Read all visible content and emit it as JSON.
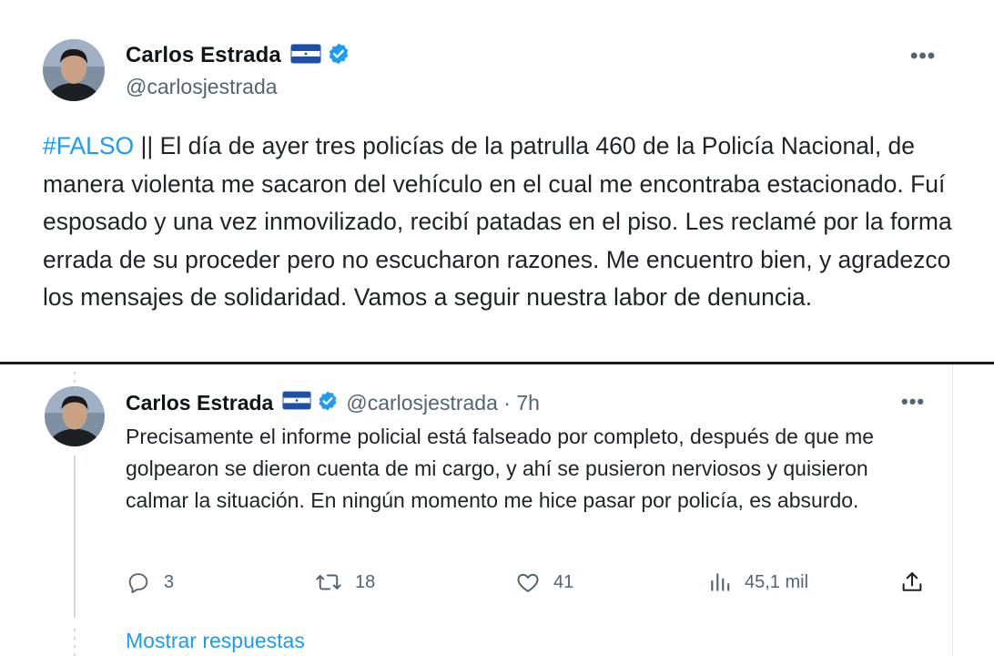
{
  "main_tweet": {
    "author_name": "Carlos Estrada",
    "handle": "@carlosjestrada",
    "more_label": "•••",
    "hashtag": "#FALSO",
    "body": " || El día de ayer tres policías de la patrulla 460 de la Policía Nacional, de manera violenta me sacaron del vehículo en el cual me encontraba estacionado. Fuí esposado y una vez inmovilizado, recibí patadas en el piso. Les reclamé por la forma errada de su proceder pero no escucharon razones. Me encuentro bien, y agradezco los mensajes de solidaridad. Vamos a seguir nuestra labor de denuncia."
  },
  "reply_tweet": {
    "author_name": "Carlos Estrada",
    "handle_time": "@carlosjestrada · 7h",
    "more_label": "•••",
    "body": "Precisamente el informe policial está falseado por completo, después de que me golpearon se dieron cuenta de mi cargo, y ahí se pusieron nerviosos y quisieron calmar la situación. En ningún momento me hice pasar por policía, es absurdo.",
    "actions": {
      "replies": "3",
      "retweets": "18",
      "likes": "41",
      "views": "45,1 mil"
    },
    "show_replies": "Mostrar respuestas"
  },
  "colors": {
    "link": "#1d9bf0",
    "secondary_text": "#536471",
    "verified": "#1d9bf0",
    "flag_blue": "#1f4fa8"
  },
  "icons": [
    "flag-honduras-icon",
    "verified-badge-icon",
    "more-icon",
    "reply-icon",
    "retweet-icon",
    "like-icon",
    "views-icon",
    "share-icon"
  ]
}
